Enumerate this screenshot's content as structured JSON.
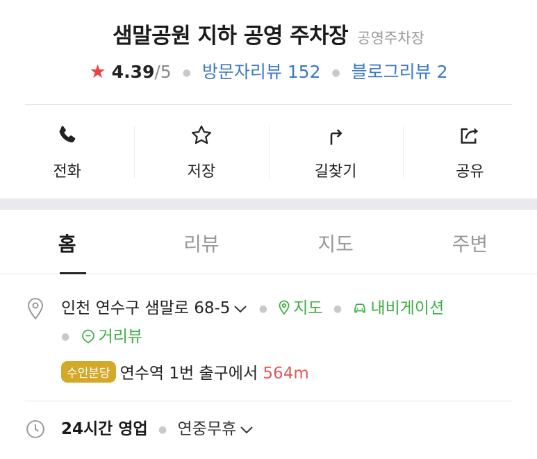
{
  "place": {
    "title": "샘말공원 지하 공영 주차장",
    "category": "공영주차장",
    "rating": "4.39",
    "rating_max": "/5",
    "visitor_reviews": "방문자리뷰 152",
    "blog_reviews": "블로그리뷰 2"
  },
  "actions": [
    {
      "label": "전화",
      "icon": "phone-icon"
    },
    {
      "label": "저장",
      "icon": "star-outline-icon"
    },
    {
      "label": "길찾기",
      "icon": "directions-arrow-icon"
    },
    {
      "label": "공유",
      "icon": "share-icon"
    }
  ],
  "tabs": [
    {
      "label": "홈",
      "active": true
    },
    {
      "label": "리뷰",
      "active": false
    },
    {
      "label": "지도",
      "active": false
    },
    {
      "label": "주변",
      "active": false
    }
  ],
  "address": {
    "text": "인천 연수구 샘말로 68-5",
    "map_link": "지도",
    "navigation_link": "내비게이션",
    "streetview_link": "거리뷰"
  },
  "subway": {
    "line_badge": "수인분당",
    "station_text": "연수역 1번 출구에서",
    "distance": "564m",
    "badge_color": "#d4a829"
  },
  "hours": {
    "status": "24시간 영업",
    "holiday": "연중무휴"
  },
  "colors": {
    "accent_green": "#3cae43",
    "link_blue": "#3a77c8",
    "star_red": "#e8413e",
    "distance_red": "#e0575a"
  }
}
